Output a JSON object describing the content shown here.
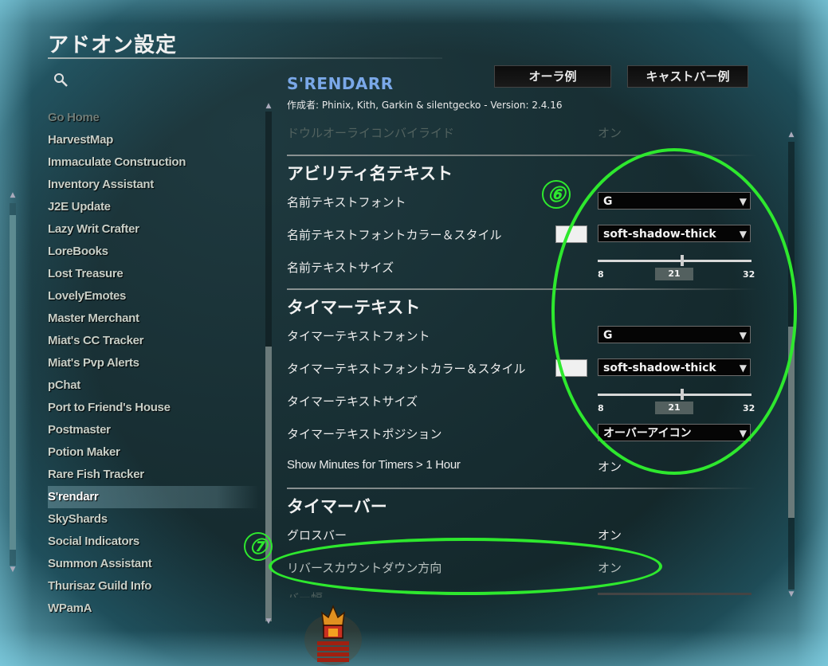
{
  "window": {
    "title": "アドオン設定"
  },
  "addon_list": [
    {
      "label": "Go Home",
      "state": "faded"
    },
    {
      "label": "HarvestMap",
      "state": "normal"
    },
    {
      "label": "Immaculate Construction",
      "state": "normal"
    },
    {
      "label": "Inventory Assistant",
      "state": "normal"
    },
    {
      "label": "J2E Update",
      "state": "normal"
    },
    {
      "label": "Lazy Writ Crafter",
      "state": "normal"
    },
    {
      "label": "LoreBooks",
      "state": "normal"
    },
    {
      "label": "Lost Treasure",
      "state": "normal"
    },
    {
      "label": "LovelyEmotes",
      "state": "normal"
    },
    {
      "label": "Master Merchant",
      "state": "normal"
    },
    {
      "label": "Miat's CC Tracker",
      "state": "normal"
    },
    {
      "label": "Miat's Pvp Alerts",
      "state": "normal"
    },
    {
      "label": "pChat",
      "state": "normal"
    },
    {
      "label": "Port to Friend's House",
      "state": "normal"
    },
    {
      "label": "Postmaster",
      "state": "normal"
    },
    {
      "label": "Potion Maker",
      "state": "normal"
    },
    {
      "label": "Rare Fish Tracker",
      "state": "normal"
    },
    {
      "label": "S'rendarr",
      "state": "selected"
    },
    {
      "label": "SkyShards",
      "state": "normal"
    },
    {
      "label": "Social Indicators",
      "state": "normal"
    },
    {
      "label": "Summon Assistant",
      "state": "normal"
    },
    {
      "label": "Thurisaz Guild Info",
      "state": "normal"
    },
    {
      "label": "WPamA",
      "state": "normal"
    }
  ],
  "tabs": {
    "aura_example": "オーラ例",
    "castbar_example": "キャストバー例"
  },
  "addon_header": {
    "name": "S'RENDARR",
    "author": "作成者: Phinix, Kith, Garkin & silentgecko - Version: 2.4.16"
  },
  "settings": {
    "cut_top_label": "ドウルオーライコンバイライド",
    "cut_top_value": "オン",
    "ability_section": {
      "header": "アビリティ名テキスト",
      "font_label": "名前テキストフォント",
      "font_value": "G",
      "color_style_label": "名前テキストフォントカラー＆スタイル",
      "color_style_value": "soft-shadow-thick",
      "size_label": "名前テキストサイズ",
      "size_min": "8",
      "size_value": "21",
      "size_max": "32"
    },
    "timer_section": {
      "header": "タイマーテキスト",
      "font_label": "タイマーテキストフォント",
      "font_value": "G",
      "color_style_label": "タイマーテキストフォントカラー＆スタイル",
      "color_style_value": "soft-shadow-thick",
      "size_label": "タイマーテキストサイズ",
      "size_min": "8",
      "size_value": "21",
      "size_max": "32",
      "position_label": "タイマーテキストポジション",
      "position_value": "オーバーアイコン",
      "show_minutes_label": "Show Minutes for Timers > 1 Hour",
      "show_minutes_value": "オン"
    },
    "timerbar_section": {
      "header": "タイマーバー",
      "gloss_label": "グロスバー",
      "gloss_value": "オン",
      "reverse_label": "リバースカウントダウン方向",
      "reverse_value": "オン",
      "bar_width_label": "バー幅"
    }
  },
  "annotations": {
    "six": "⑥",
    "seven": "⑦"
  },
  "colors": {
    "accent_name": "#7aa8e8",
    "annotation_green": "#2ee82e"
  },
  "icons": [
    "search-icon",
    "scroll-up-arrow-icon",
    "scroll-down-arrow-icon",
    "dropdown-caret-icon",
    "tower-icon"
  ]
}
